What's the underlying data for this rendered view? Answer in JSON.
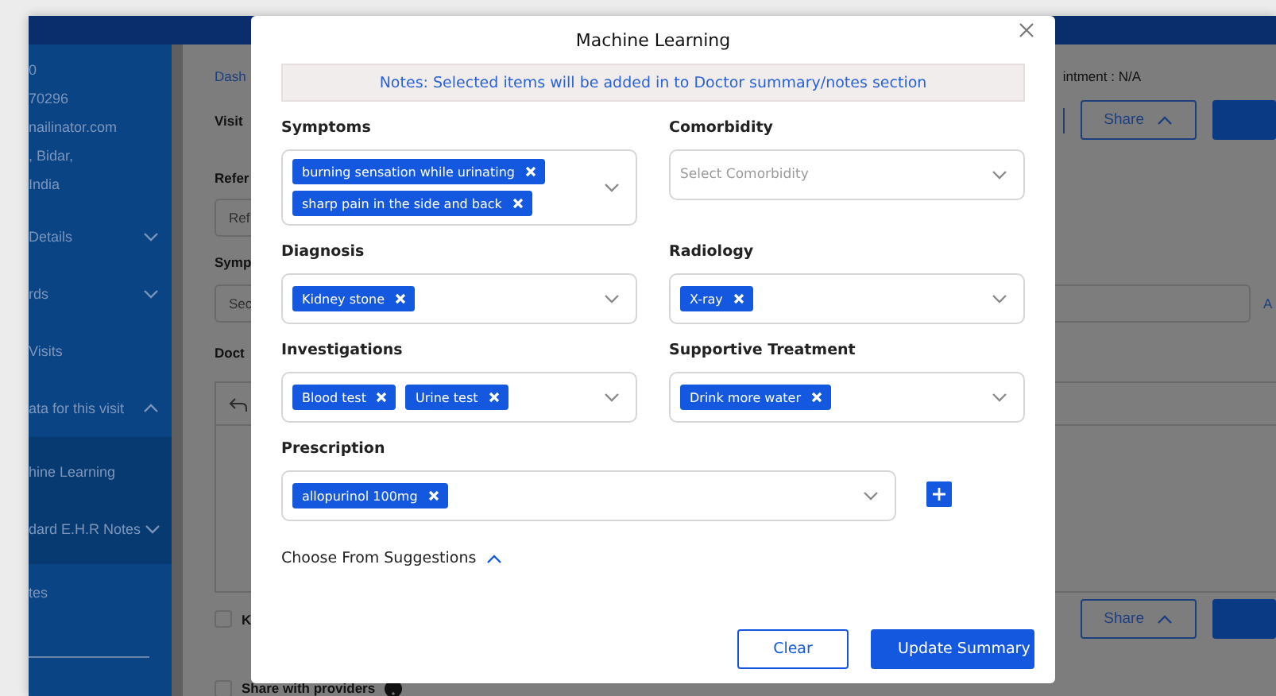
{
  "app": {
    "profile_lines": [
      "0",
      "70296",
      "nailinator.com",
      ", Bidar,",
      "India"
    ],
    "nav": [
      {
        "label": "Details",
        "expanded": false
      },
      {
        "label": "rds",
        "expanded": false
      },
      {
        "label": "Visits"
      },
      {
        "label": "ata for this visit",
        "expanded": true,
        "children": [
          {
            "label": "hine Learning"
          },
          {
            "label": "dard E.H.R Notes",
            "expanded": false
          }
        ]
      },
      {
        "label": "tes"
      }
    ],
    "breadcrumb": "Dash",
    "appointment": "intment : N/A",
    "visit_label": "Visit",
    "top_share": "Share",
    "referral_label": "Refer",
    "referral_placeholder": "Ref",
    "symptoms_label": "Symp",
    "symptoms_placeholder": "Sec",
    "add_link": "A",
    "doctor_label": "Doct",
    "checkboxes": [
      {
        "label": "K",
        "checked": false
      },
      {
        "label": "Share with providers",
        "checked": false
      }
    ],
    "bottom_share": "Share"
  },
  "modal": {
    "title": "Machine Learning",
    "notes": "Notes: Selected items will be added in to Doctor summary/notes section",
    "fields": [
      {
        "label": "Symptoms",
        "chips": [
          "burning sensation while urinating",
          "sharp pain in the side and back"
        ]
      },
      {
        "label": "Comorbidity",
        "placeholder": "Select Comorbidity"
      },
      {
        "label": "Diagnosis",
        "chips": [
          "Kidney stone"
        ]
      },
      {
        "label": "Radiology",
        "chips": [
          "X-ray"
        ]
      },
      {
        "label": "Investigations",
        "chips": [
          "Blood test",
          "Urine test"
        ]
      },
      {
        "label": "Supportive Treatment",
        "chips": [
          "Drink more water"
        ]
      }
    ],
    "prescription": {
      "label": "Prescription",
      "chips": [
        "allopurinol 100mg"
      ]
    },
    "suggestions": {
      "label": "Choose From Suggestions",
      "expanded": true
    },
    "buttons": [
      {
        "label": "Clear",
        "kind": "secondary"
      },
      {
        "label": "Update Summary",
        "kind": "primary"
      }
    ]
  }
}
